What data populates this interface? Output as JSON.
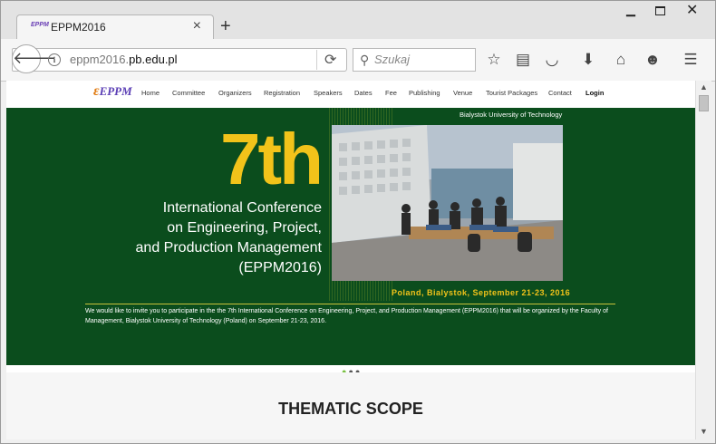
{
  "browser": {
    "tab_title": "EPPM2016",
    "tab_favicon_text": "EPPM",
    "close_tab_glyph": "×",
    "new_tab_glyph": "+",
    "url_prefix": "eppm2016.",
    "url_domain": "pb.edu.pl",
    "search_placeholder": "Szukaj",
    "icons": [
      "back-icon",
      "info-icon",
      "reload-icon",
      "search-icon",
      "bookmark-star-icon",
      "reading-list-icon",
      "pocket-icon",
      "download-icon",
      "home-icon",
      "smiley-icon",
      "menu-icon"
    ]
  },
  "site": {
    "logo_text": "EPPM",
    "nav": [
      "Home",
      "Committee",
      "Organizers",
      "Registration",
      "Speakers",
      "Dates",
      "Fee",
      "Publishing",
      "Venue",
      "Tourist Packages",
      "Contact",
      "Login"
    ],
    "hero": {
      "university": "Bialystok University of Technology",
      "big_number": "7th",
      "title_lines": [
        "International Conference",
        "on Engineering, Project,",
        "and Production Management",
        "(EPPM2016)"
      ],
      "date_location": "Poland, Bialystok, September 21-23, 2016",
      "intro": "We would like to invite you to participate in the the 7th International Conference on Engineering, Project, and Production Management (EPPM2016) that will be organized by the Faculty of Management, Bialystok University of Technology (Poland) on September 21-23, 2016."
    },
    "slider_dots": 3,
    "section_heading": "THEMATIC SCOPE"
  },
  "colors": {
    "hero_green": "#0b4d1d",
    "accent_yellow": "#f2c31a",
    "logo_purple": "#5b3fb5"
  }
}
